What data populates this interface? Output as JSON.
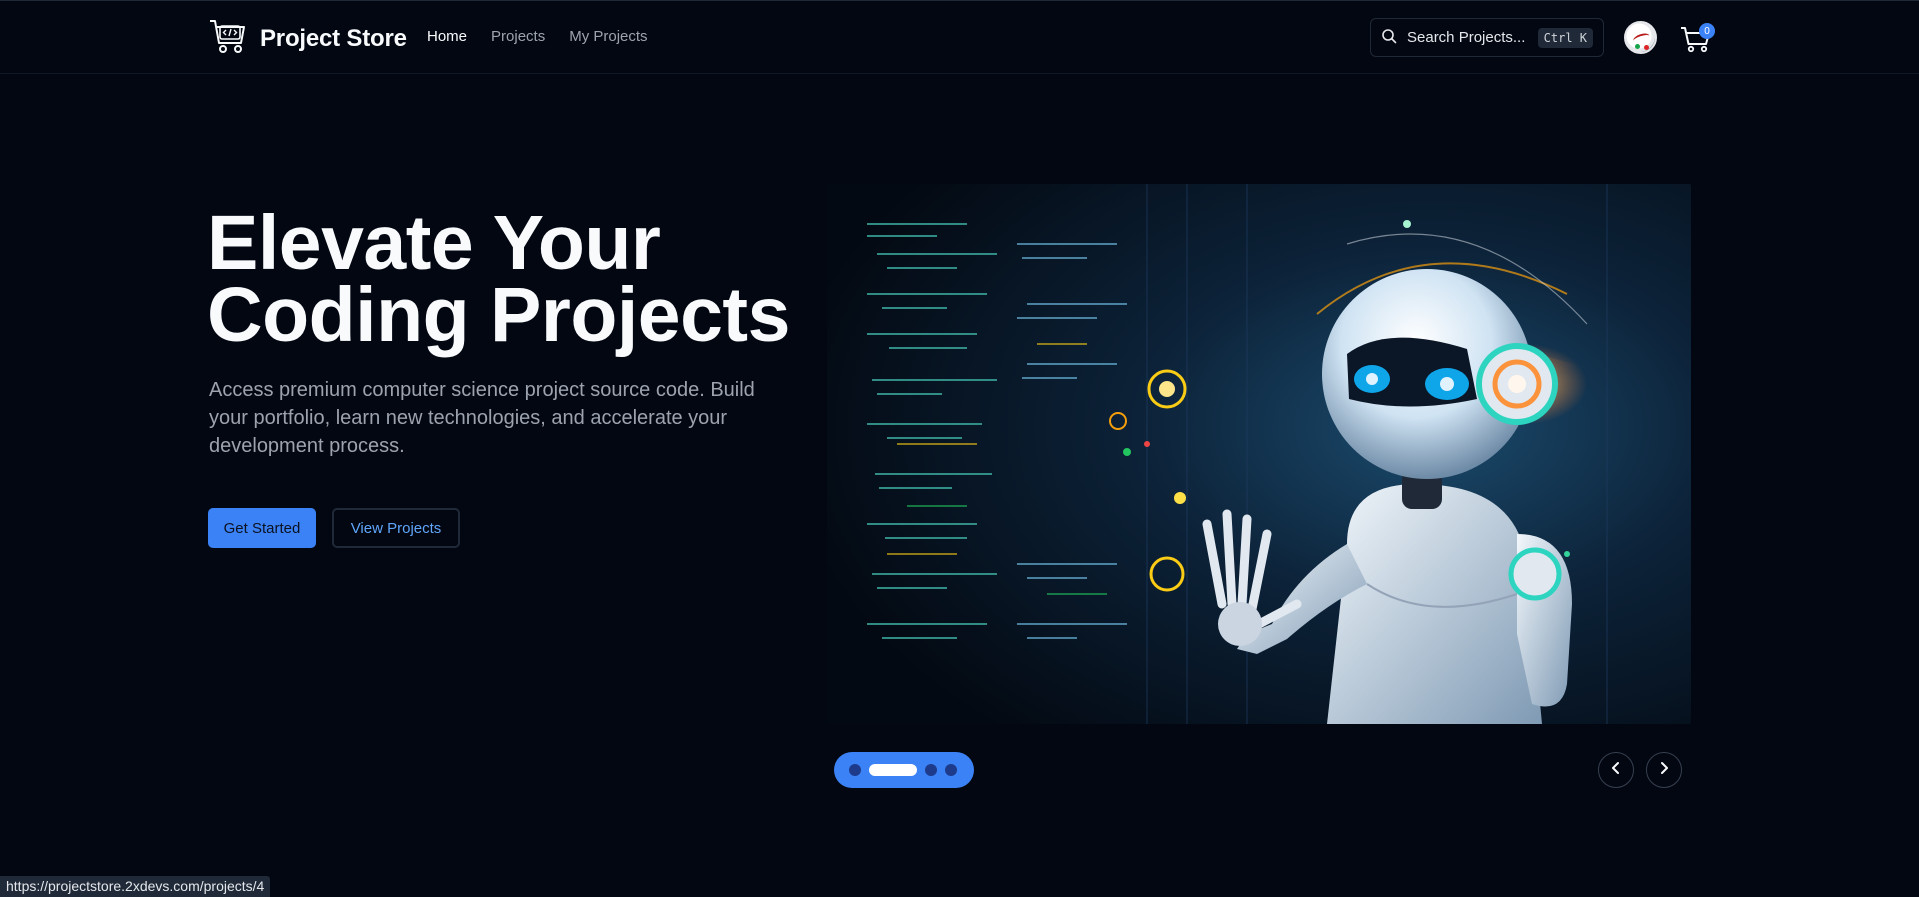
{
  "header": {
    "brand_title": "Project Store",
    "nav": [
      {
        "label": "Home",
        "active": true
      },
      {
        "label": "Projects",
        "active": false
      },
      {
        "label": "My Projects",
        "active": false
      }
    ],
    "search": {
      "label": "Search Projects...",
      "shortcut": "Ctrl K"
    },
    "cart_count": "0"
  },
  "hero": {
    "title_line1": "Elevate Your",
    "title_line2": "Coding Projects",
    "subtitle": "Access premium computer science project source code. Build your portfolio, learn new technologies, and accelerate your development process.",
    "primary_button": "Get Started",
    "secondary_button": "View Projects"
  },
  "carousel": {
    "slide_count": 4,
    "active_index": 1,
    "accent_color": "#3b82f6"
  },
  "status_bar": {
    "url": "https://projectstore.2xdevs.com/projects/4"
  },
  "colors": {
    "background": "#030712",
    "accent": "#3b82f6",
    "muted_text": "#9ca3af"
  }
}
